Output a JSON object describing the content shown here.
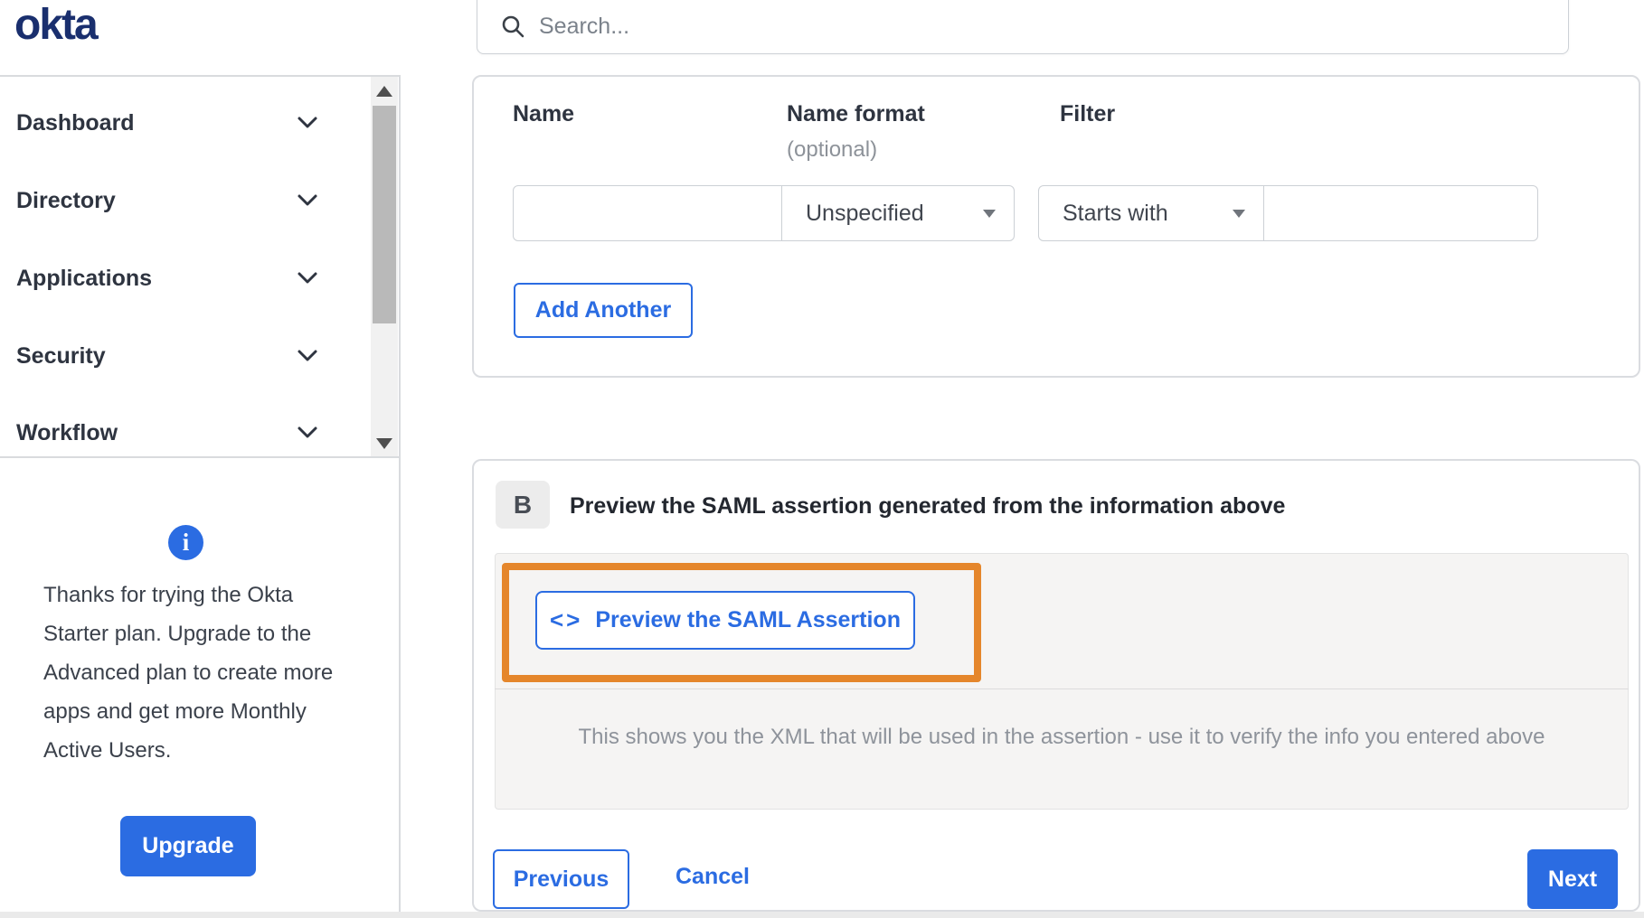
{
  "header": {
    "logo": "okta",
    "search_placeholder": "Search..."
  },
  "sidebar": {
    "items": [
      {
        "label": "Dashboard"
      },
      {
        "label": "Directory"
      },
      {
        "label": "Applications"
      },
      {
        "label": "Security"
      },
      {
        "label": "Workflow"
      }
    ]
  },
  "plan_banner": {
    "info_icon": "i",
    "message": "Thanks for trying the Okta Starter plan. Upgrade to the Advanced plan to create more apps and get more Monthly Active Users.",
    "upgrade_label": "Upgrade"
  },
  "attribute_form": {
    "columns": {
      "name": "Name",
      "name_format": "Name format",
      "name_format_note": "(optional)",
      "filter": "Filter"
    },
    "row": {
      "name_value": "",
      "name_format_value": "Unspecified",
      "filter_type_value": "Starts with",
      "filter_value": ""
    },
    "add_another_label": "Add Another"
  },
  "preview_section": {
    "badge": "B",
    "title": "Preview the SAML assertion generated from the information above",
    "preview_icon": "<>",
    "preview_button_label": "Preview the SAML Assertion",
    "note": "This shows you the XML that will be used in the assertion - use it to verify the info you entered above"
  },
  "footer": {
    "previous_label": "Previous",
    "cancel_label": "Cancel",
    "next_label": "Next"
  },
  "colors": {
    "accent_blue": "#2b6ce2",
    "logo_navy": "#1a2f6e",
    "annotation_orange": "#e5862b",
    "panel_gray": "#f5f4f3"
  }
}
